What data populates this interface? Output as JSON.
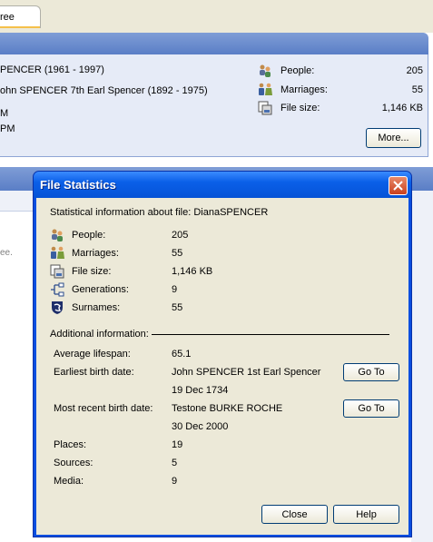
{
  "app": {
    "tab_label": "ree",
    "panel": {
      "line1": "PENCER  (1961 - 1997)",
      "line2": "ohn SPENCER 7th Earl Spencer  (1892 - 1975)",
      "line3": "M",
      "line4": "PM",
      "stats": [
        {
          "label": "People:",
          "value": "205",
          "icon": "people-icon"
        },
        {
          "label": "Marriages:",
          "value": "55",
          "icon": "marriages-icon"
        },
        {
          "label": "File size:",
          "value": "1,146 KB",
          "icon": "file-size-icon"
        }
      ],
      "more_label": "More..."
    },
    "faint_text": "ee."
  },
  "dialog": {
    "title": "File Statistics",
    "intro": "Statistical information about file: DianaSPENCER",
    "stats": [
      {
        "label": "People:",
        "value": "205",
        "icon": "people-icon"
      },
      {
        "label": "Marriages:",
        "value": "55",
        "icon": "marriages-icon"
      },
      {
        "label": "File size:",
        "value": "1,146 KB",
        "icon": "file-size-icon"
      },
      {
        "label": "Generations:",
        "value": "9",
        "icon": "generations-icon"
      },
      {
        "label": "Surnames:",
        "value": "55",
        "icon": "surnames-icon"
      }
    ],
    "additional_label": "Additional information:",
    "average_lifespan_label": "Average lifespan:",
    "average_lifespan_value": "65.1",
    "earliest_label": "Earliest birth date:",
    "earliest_name": "John SPENCER 1st Earl Spencer",
    "earliest_date": "19 Dec 1734",
    "recent_label": "Most recent birth date:",
    "recent_name": "Testone BURKE ROCHE",
    "recent_date": "30 Dec 2000",
    "places_label": "Places:",
    "places_value": "19",
    "sources_label": "Sources:",
    "sources_value": "5",
    "media_label": "Media:",
    "media_value": "9",
    "goto_label": "Go To",
    "close_label": "Close",
    "help_label": "Help"
  }
}
